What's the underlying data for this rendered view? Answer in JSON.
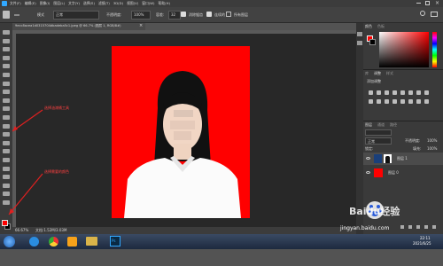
{
  "menu": {
    "items": [
      "文件(F)",
      "编辑(E)",
      "图像(I)",
      "图层(L)",
      "文字(Y)",
      "选择(S)",
      "滤镜(T)",
      "3D(D)",
      "视图(V)",
      "窗口(W)",
      "帮助(H)"
    ]
  },
  "options": {
    "mode_label": "模式",
    "mode_value": "正常",
    "opacity_label": "不透明度:",
    "opacity_value": "100%",
    "tolerance_label": "容差:",
    "tolerance_value": "32",
    "antialias_label": "消除锯齿",
    "contiguous_label": "连续的",
    "all_layers_label": "所有图层"
  },
  "document": {
    "tab_title": "9ecc8acea1d0315704dbadeba5c1.jpeg @ 66.7% (图层 1, RGB/8#)"
  },
  "annotations": {
    "arrow1": "选择油漆桶工具",
    "arrow2": "选择需要的颜色"
  },
  "status": {
    "zoom": "66.67%",
    "doc_info": "文档:1.52M/3.03M"
  },
  "panels": {
    "color_tabs": [
      "颜色",
      "色板"
    ],
    "adjust_tabs": [
      "库",
      "调整",
      "样式"
    ],
    "adjust_add": "添加调整",
    "layers_tabs": [
      "图层",
      "通道",
      "路径"
    ],
    "blend_mode": "正常",
    "opacity_label": "不透明度:",
    "opacity_value": "100%",
    "lock_label": "锁定:",
    "fill_label": "填充:",
    "fill_value": "100%",
    "layers": [
      {
        "name": "图层 1"
      },
      {
        "name": "图层 0"
      }
    ]
  },
  "taskbar": {
    "time": "22:11",
    "date": "2021/6/25"
  },
  "watermark": {
    "brand": "Baidu经验",
    "url": "jingyan.baidu.com"
  },
  "colors": {
    "fg": "#ff0000",
    "bg": "#000000",
    "canvas": "#ff0000",
    "accent": "#e02020"
  }
}
